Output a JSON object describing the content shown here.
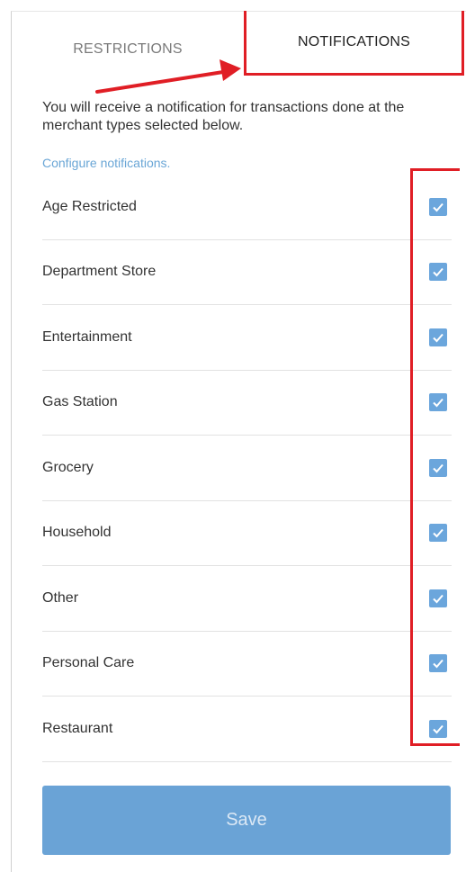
{
  "tabs": {
    "restrictions": "RESTRICTIONS",
    "notifications": "NOTIFICATIONS"
  },
  "intro_text": "You will receive a notification for transactions done at the merchant types selected below.",
  "configure_link": "Configure notifications.",
  "merchant_types": [
    {
      "label": "Age Restricted",
      "checked": true
    },
    {
      "label": "Department Store",
      "checked": true
    },
    {
      "label": "Entertainment",
      "checked": true
    },
    {
      "label": "Gas Station",
      "checked": true
    },
    {
      "label": "Grocery",
      "checked": true
    },
    {
      "label": "Household",
      "checked": true
    },
    {
      "label": "Other",
      "checked": true
    },
    {
      "label": "Personal Care",
      "checked": true
    },
    {
      "label": "Restaurant",
      "checked": true
    }
  ],
  "save_label": "Save",
  "colors": {
    "accent": "#6aa6d6",
    "annotation": "#e01e25",
    "checkbox": "#6ba6dc"
  }
}
